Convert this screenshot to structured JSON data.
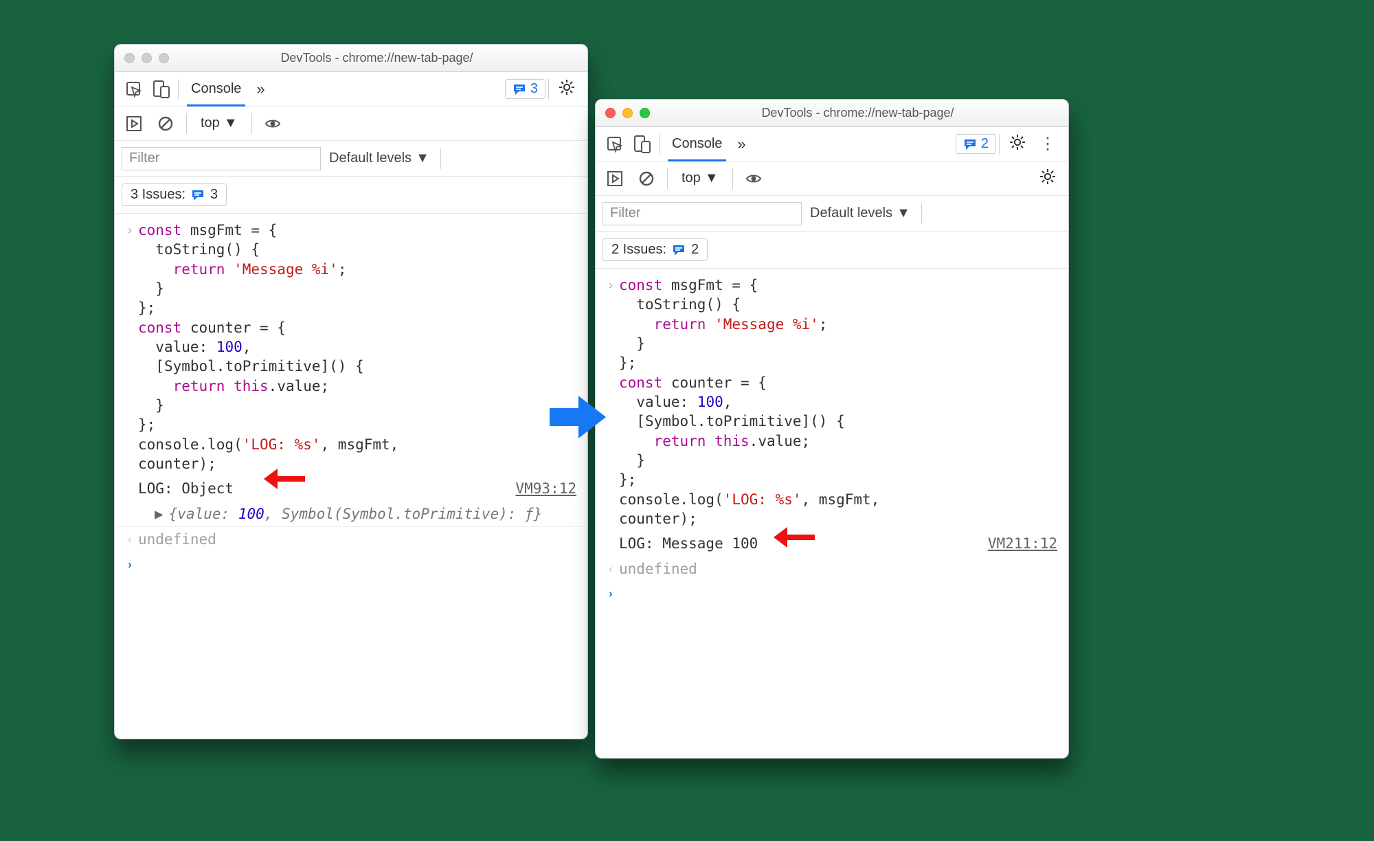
{
  "left": {
    "title": "DevTools - chrome://new-tab-page/",
    "traffic_style": "dim",
    "tabs": {
      "active": "Console"
    },
    "badge_count": "3",
    "context": "top",
    "filter_placeholder": "Filter",
    "levels_label": "Default levels",
    "issues_pre": "3 Issues:",
    "issues_count": "3",
    "code_html": "<span class=\"kw\">const</span> msgFmt = {\n  toString() {\n    <span class=\"kw\">return</span> <span class=\"str\">'Message %i'</span>;\n  }\n};\n<span class=\"kw\">const</span> counter = {\n  value: <span class=\"num\">100</span>,\n  [Symbol.toPrimitive]() {\n    <span class=\"kw\">return</span> <span class=\"kw\">this</span>.value;\n  }\n};\nconsole.log(<span class=\"str\">'LOG: %s'</span>, msgFmt,\ncounter);",
    "log_text": "LOG: Object",
    "log_src": "VM93:12",
    "obj_preview_html": "{value: <span class=\"num\">100</span>, Symbol(Symbol.toPrimitive): ƒ}",
    "undefined": "undefined"
  },
  "right": {
    "title": "DevTools - chrome://new-tab-page/",
    "traffic_style": "color",
    "tabs": {
      "active": "Console"
    },
    "badge_count": "2",
    "context": "top",
    "filter_placeholder": "Filter",
    "levels_label": "Default levels",
    "issues_pre": "2 Issues:",
    "issues_count": "2",
    "code_html": "<span class=\"kw\">const</span> msgFmt = {\n  toString() {\n    <span class=\"kw\">return</span> <span class=\"str\">'Message %i'</span>;\n  }\n};\n<span class=\"kw\">const</span> counter = {\n  value: <span class=\"num\">100</span>,\n  [Symbol.toPrimitive]() {\n    <span class=\"kw\">return</span> <span class=\"kw\">this</span>.value;\n  }\n};\nconsole.log(<span class=\"str\">'LOG: %s'</span>, msgFmt,\ncounter);",
    "log_text": "LOG: Message 100",
    "log_src": "VM211:12",
    "undefined": "undefined"
  }
}
